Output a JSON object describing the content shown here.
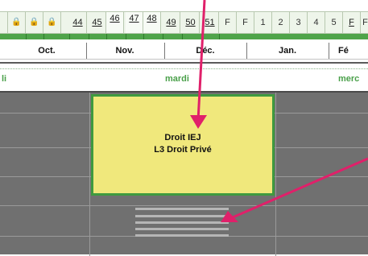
{
  "week_cells": [
    {
      "label": "🔒",
      "state": "locked"
    },
    {
      "label": "🔒",
      "state": "locked"
    },
    {
      "label": "🔒",
      "state": "locked"
    },
    {
      "label": "44",
      "state": "link"
    },
    {
      "label": "45",
      "state": "link"
    },
    {
      "label": "46",
      "state": "selected"
    },
    {
      "label": "47",
      "state": "selected"
    },
    {
      "label": "48",
      "state": "selected"
    },
    {
      "label": "49",
      "state": "link"
    },
    {
      "label": "50",
      "state": "link"
    },
    {
      "label": "51",
      "state": "link"
    },
    {
      "label": "F",
      "state": "plain"
    },
    {
      "label": "F",
      "state": "plain"
    },
    {
      "label": "1",
      "state": "plain"
    },
    {
      "label": "2",
      "state": "plain"
    },
    {
      "label": "3",
      "state": "plain"
    },
    {
      "label": "4",
      "state": "plain"
    },
    {
      "label": "5",
      "state": "plain"
    },
    {
      "label": "F",
      "state": "link"
    },
    {
      "label": "F",
      "state": "plain"
    }
  ],
  "months": [
    "Oct.",
    "Nov.",
    "Déc.",
    "Jan.",
    "Fé"
  ],
  "days": {
    "left": "li",
    "center": "mardi",
    "right": "merc"
  },
  "event": {
    "title": "Droit IEJ",
    "subtitle": "L3 Droit Privé"
  },
  "colors": {
    "accent_green": "#4fa44a",
    "event_fill": "#f0e87c",
    "arrow": "#e0206a",
    "grid": "#707070"
  },
  "icons": {
    "locked_week": "padlock-icon"
  }
}
